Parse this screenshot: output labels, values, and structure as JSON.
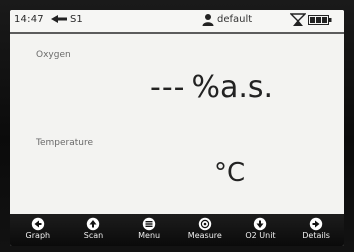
{
  "status": {
    "time": "14:47",
    "sensor": "S1",
    "user": "default"
  },
  "measurements": {
    "oxygen": {
      "label": "Oxygen",
      "value": "---",
      "unit": "%a.s."
    },
    "temperature": {
      "label": "Temperature",
      "unit": "°C"
    }
  },
  "softkeys": [
    {
      "label": "Graph",
      "icon": "arrow-left-icon"
    },
    {
      "label": "Scan",
      "icon": "arrow-up-icon"
    },
    {
      "label": "Menu",
      "icon": "menu-icon"
    },
    {
      "label": "Measure",
      "icon": "measure-icon"
    },
    {
      "label": "O2 Unit",
      "icon": "arrow-down-icon"
    },
    {
      "label": "Details",
      "icon": "arrow-right-icon"
    }
  ],
  "colors": {
    "screen_bg": "#f3f3f1",
    "softkey_bar": "#111111",
    "text": "#222222"
  }
}
